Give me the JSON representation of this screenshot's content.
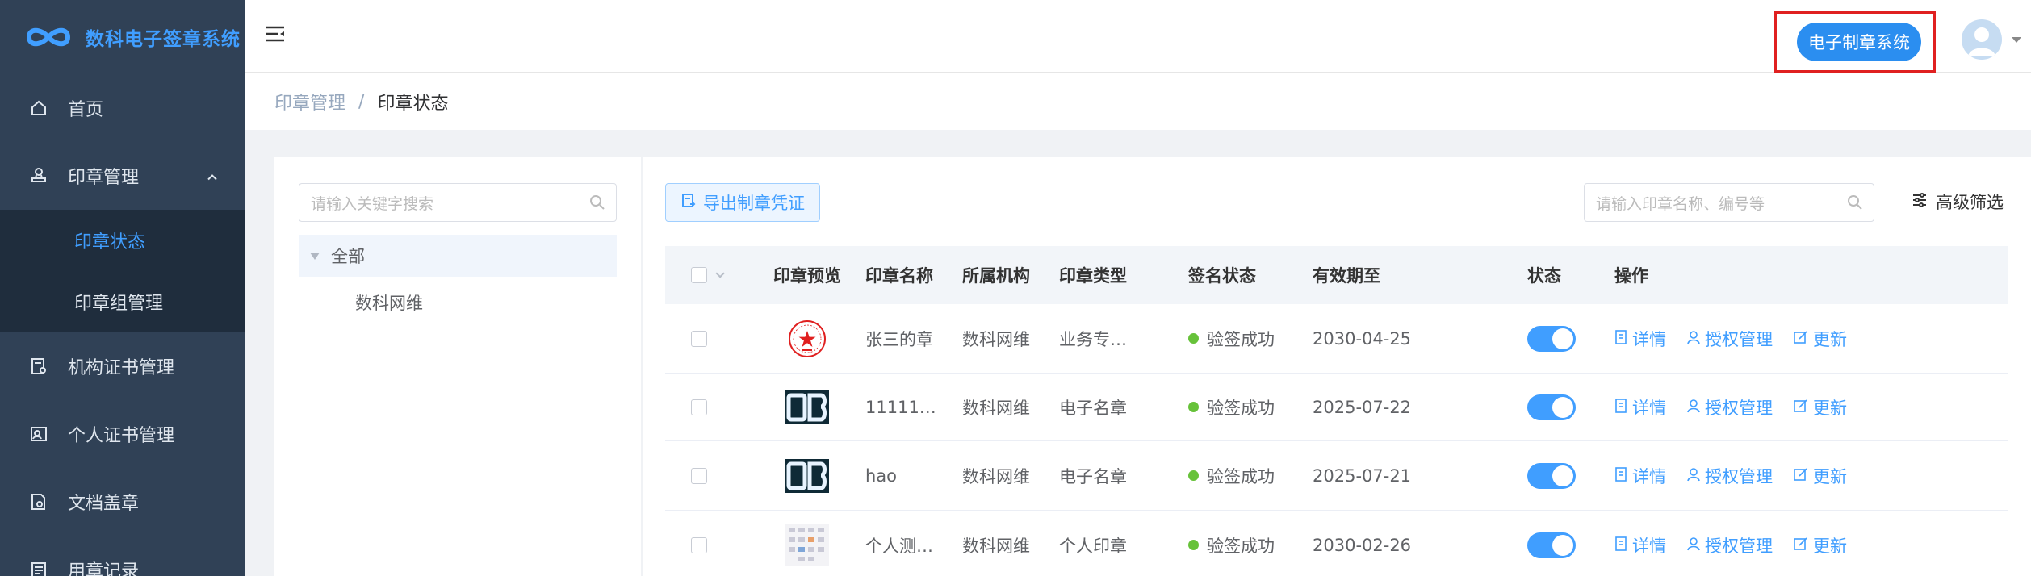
{
  "app": {
    "logo_text": "数科电子签章系统"
  },
  "sidebar": {
    "items": [
      {
        "label": "首页",
        "icon": "home-icon"
      },
      {
        "label": "印章管理",
        "icon": "stamp-icon",
        "expanded": true
      },
      {
        "label": "机构证书管理",
        "icon": "org-cert-icon"
      },
      {
        "label": "个人证书管理",
        "icon": "person-cert-icon"
      },
      {
        "label": "文档盖章",
        "icon": "doc-stamp-icon"
      },
      {
        "label": "用章记录",
        "icon": "record-icon"
      }
    ],
    "subitems": [
      {
        "label": "印章状态",
        "active": true
      },
      {
        "label": "印章组管理",
        "active": false
      }
    ]
  },
  "header": {
    "system_button": "电子制章系统",
    "highlight_color": "#e02020",
    "button_color": "#2b8ef0"
  },
  "breadcrumb": {
    "parent": "印章管理",
    "separator": "/",
    "current": "印章状态"
  },
  "tree": {
    "search_placeholder": "请输入关键字搜索",
    "root": "全部",
    "children": [
      "数科网维"
    ]
  },
  "toolbar": {
    "export_label": "导出制章凭证",
    "filter_placeholder": "请输入印章名称、编号等",
    "advanced_filter": "高级筛选"
  },
  "table": {
    "headers": {
      "preview": "印章预览",
      "name": "印章名称",
      "org": "所属机构",
      "type": "印章类型",
      "sign": "签名状态",
      "expiry": "有效期至",
      "status": "状态",
      "ops": "操作"
    },
    "rows": [
      {
        "preview": "round-red-seal",
        "name": "张三的章",
        "org": "数科网维",
        "type": "业务专…",
        "sign": "验签成功",
        "expiry": "2030-04-25",
        "enabled": true
      },
      {
        "preview": "dark-logo-seal",
        "name": "11111…",
        "org": "数科网维",
        "type": "电子名章",
        "sign": "验签成功",
        "expiry": "2025-07-22",
        "enabled": true
      },
      {
        "preview": "dark-logo-seal",
        "name": "hao",
        "org": "数科网维",
        "type": "电子名章",
        "sign": "验签成功",
        "expiry": "2025-07-21",
        "enabled": true
      },
      {
        "preview": "grid-seal",
        "name": "个人测…",
        "org": "数科网维",
        "type": "个人印章",
        "sign": "验签成功",
        "expiry": "2030-02-26",
        "enabled": true
      }
    ],
    "ops": {
      "detail": "详情",
      "auth": "授权管理",
      "update": "更新"
    }
  }
}
